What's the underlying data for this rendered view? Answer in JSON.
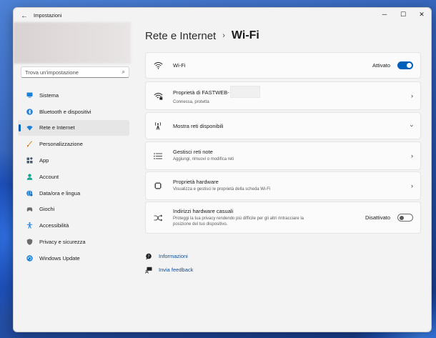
{
  "window": {
    "app_title": "Impostazioni",
    "controls": {
      "minimize": "─",
      "maximize": "☐",
      "close": "✕"
    }
  },
  "search": {
    "placeholder": "Trova un'impostazione"
  },
  "sidebar": {
    "items": [
      {
        "label": "Sistema",
        "icon": "monitor-icon",
        "color": "#1f7fd6",
        "active": false
      },
      {
        "label": "Bluetooth e dispositivi",
        "icon": "bluetooth-icon",
        "color": "#1f7fd6",
        "active": false
      },
      {
        "label": "Rete e Internet",
        "icon": "wifi-diamond-icon",
        "color": "#1f7fd6",
        "active": true
      },
      {
        "label": "Personalizzazione",
        "icon": "brush-icon",
        "color": "#e0862a",
        "active": false
      },
      {
        "label": "App",
        "icon": "apps-icon",
        "color": "#4a5a6a",
        "active": false
      },
      {
        "label": "Account",
        "icon": "person-icon",
        "color": "#17a38c",
        "active": false
      },
      {
        "label": "Data/ora e lingua",
        "icon": "globe-clock-icon",
        "color": "#1f7fd6",
        "active": false
      },
      {
        "label": "Giochi",
        "icon": "gamepad-icon",
        "color": "#6b6b6b",
        "active": false
      },
      {
        "label": "Accessibilità",
        "icon": "accessibility-icon",
        "color": "#1f7fd6",
        "active": false
      },
      {
        "label": "Privacy e sicurezza",
        "icon": "shield-icon",
        "color": "#6b6b6b",
        "active": false
      },
      {
        "label": "Windows Update",
        "icon": "update-icon",
        "color": "#1f7fd6",
        "active": false
      }
    ]
  },
  "breadcrumb": {
    "parent": "Rete e Internet",
    "separator": "›",
    "current": "Wi-Fi"
  },
  "cards": {
    "wifi": {
      "title": "Wi-Fi",
      "toggle_label": "Attivato",
      "on": true
    },
    "properties": {
      "title": "Proprietà di FASTWEB-",
      "subtitle": "Connessa, protetta"
    },
    "networks": {
      "title": "Mostra reti disponibili"
    },
    "manage": {
      "title": "Gestisci reti note",
      "subtitle": "Aggiungi, rimuovi o modifica reti"
    },
    "hardware": {
      "title": "Proprietà hardware",
      "subtitle": "Visualizza e gestisci le proprietà della scheda Wi-Fi"
    },
    "random_mac": {
      "title": "Indirizzi hardware casuali",
      "subtitle_line1": "Proteggi la tua privacy rendendo più difficile per gli altri rintracciare la",
      "subtitle_line2": "posizione del tuo dispositivo.",
      "toggle_label": "Disattivato",
      "on": false
    }
  },
  "links": {
    "info": "Informazioni",
    "feedback": "Invia feedback"
  },
  "colors": {
    "accent": "#005fb8",
    "link": "#0a4f9c"
  }
}
